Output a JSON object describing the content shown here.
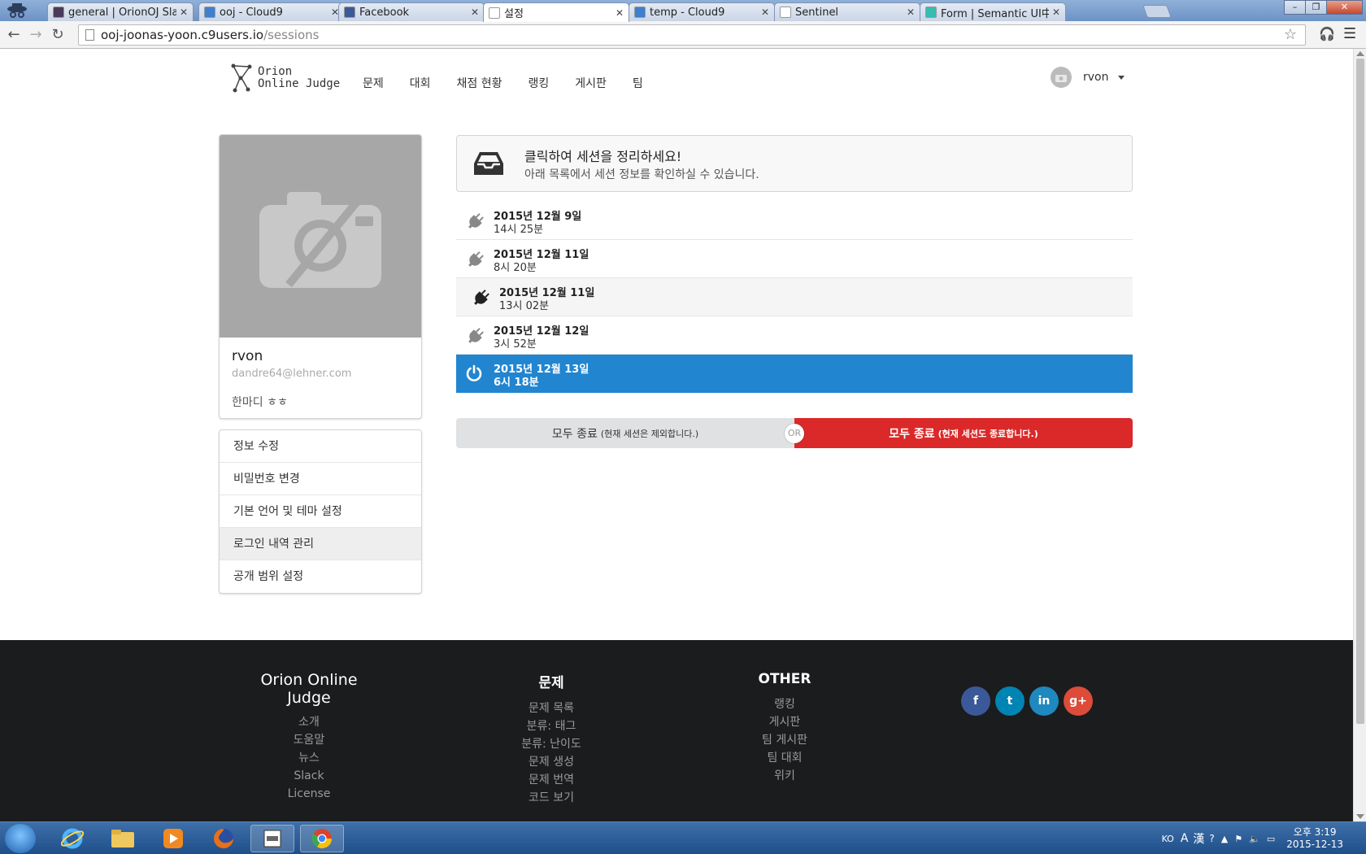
{
  "browser": {
    "tabs": [
      {
        "title": "general | OrionOJ Slack",
        "favicon_color": "#4a3b5c",
        "active": false
      },
      {
        "title": "ooj - Cloud9",
        "favicon_color": "#3f7fd0",
        "active": false
      },
      {
        "title": "Facebook",
        "favicon_color": "#3b5998",
        "active": false
      },
      {
        "title": "설정",
        "favicon_color": "#ffffff",
        "active": true
      },
      {
        "title": "temp - Cloud9",
        "favicon_color": "#3f7fd0",
        "active": false
      },
      {
        "title": "Sentinel",
        "favicon_color": "#ffffff",
        "active": false
      },
      {
        "title": "Form | Semantic UI中文官",
        "favicon_color": "#35bdb2",
        "active": false
      }
    ],
    "url_host": "ooj-joonas-yoon.c9users.io",
    "url_path": "/sessions"
  },
  "site": {
    "logo_line1": "Orion",
    "logo_line2": "Online Judge",
    "nav": [
      "문제",
      "대회",
      "채점 현황",
      "랭킹",
      "게시판",
      "팀"
    ],
    "user_name": "rvon"
  },
  "profile": {
    "name": "rvon",
    "email": "dandre64@lehner.com",
    "bio": "한마디 ㅎㅎ"
  },
  "settings_menu": [
    {
      "label": "정보 수정",
      "active": false
    },
    {
      "label": "비밀번호 변경",
      "active": false
    },
    {
      "label": "기본 언어 및 테마 설정",
      "active": false
    },
    {
      "label": "로그인 내역 관리",
      "active": true
    },
    {
      "label": "공개 범위 설정",
      "active": false
    }
  ],
  "info": {
    "header": "클릭하여 세션을 정리하세요!",
    "sub": "아래 목록에서 세션 정보를 확인하실 수 있습니다."
  },
  "sessions": [
    {
      "date": "2015년 12월 9일",
      "time": "14시 25분",
      "state": "normal"
    },
    {
      "date": "2015년 12월 11일",
      "time": "8시 20분",
      "state": "normal"
    },
    {
      "date": "2015년 12월 11일",
      "time": "13시 02분",
      "state": "hover"
    },
    {
      "date": "2015년 12월 12일",
      "time": "3시 52분",
      "state": "normal"
    },
    {
      "date": "2015년 12월 13일",
      "time": "6시 18분",
      "state": "current"
    }
  ],
  "buttons": {
    "left_label": "모두 종료",
    "left_note": "(현재 세션은 제외합니다.)",
    "or_label": "OR",
    "right_label": "모두 종료",
    "right_note": "(현재 세션도 종료합니다.)"
  },
  "footer": {
    "brand": "Orion Online Judge",
    "brand_links": [
      "소개",
      "도움말",
      "뉴스",
      "Slack",
      "License"
    ],
    "problem_title": "문제",
    "problem_links": [
      "문제 목록",
      "분류: 태그",
      "분류: 난이도",
      "문제 생성",
      "문제 번역",
      "코드 보기"
    ],
    "other_title": "OTHER",
    "other_links": [
      "랭킹",
      "게시판",
      "팀 게시판",
      "팀 대회",
      "위키"
    ],
    "social": [
      {
        "name": "facebook",
        "glyph": "f",
        "color": "#3b5998"
      },
      {
        "name": "twitter",
        "glyph": "t",
        "color": "#0084b4"
      },
      {
        "name": "linkedin",
        "glyph": "in",
        "color": "#1f88be"
      },
      {
        "name": "google-plus",
        "glyph": "g+",
        "color": "#dd4b39"
      }
    ]
  },
  "taskbar": {
    "lang": "KO",
    "time": "오후 3:19",
    "date": "2015-12-13"
  },
  "colors": {
    "primary": "#2185d0",
    "danger": "#db2828",
    "footer_bg": "#1b1c1d"
  }
}
